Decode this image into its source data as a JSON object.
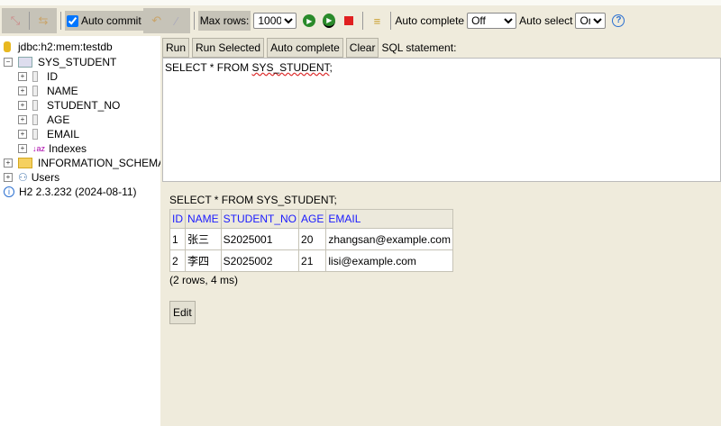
{
  "toolbar": {
    "auto_commit": "Auto commit",
    "max_rows_label": "Max rows:",
    "max_rows": "1000",
    "auto_complete_label": "Auto complete",
    "auto_complete": "Off",
    "auto_select_label": "Auto select",
    "auto_select": "On",
    "help": "?"
  },
  "tree": {
    "connection": "jdbc:h2:mem:testdb",
    "table": "SYS_STUDENT",
    "columns": [
      "ID",
      "NAME",
      "STUDENT_NO",
      "AGE",
      "EMAIL"
    ],
    "indexes": "Indexes",
    "schema": "INFORMATION_SCHEMA",
    "users": "Users",
    "version": "H2 2.3.232 (2024-08-11)"
  },
  "editor": {
    "run": "Run",
    "run_selected": "Run Selected",
    "auto_complete": "Auto complete",
    "clear": "Clear",
    "sql_label": "SQL statement:",
    "sql_pre": "SELECT * FROM ",
    "sql_table": "SYS_STUDENT",
    "sql_post": ";"
  },
  "result": {
    "query": "SELECT * FROM SYS_STUDENT;",
    "headers": [
      "ID",
      "NAME",
      "STUDENT_NO",
      "AGE",
      "EMAIL"
    ],
    "rows": [
      [
        "1",
        "张三",
        "S2025001",
        "20",
        "zhangsan@example.com"
      ],
      [
        "2",
        "李四",
        "S2025002",
        "21",
        "lisi@example.com"
      ]
    ],
    "summary": "(2 rows, 4 ms)",
    "edit": "Edit"
  }
}
